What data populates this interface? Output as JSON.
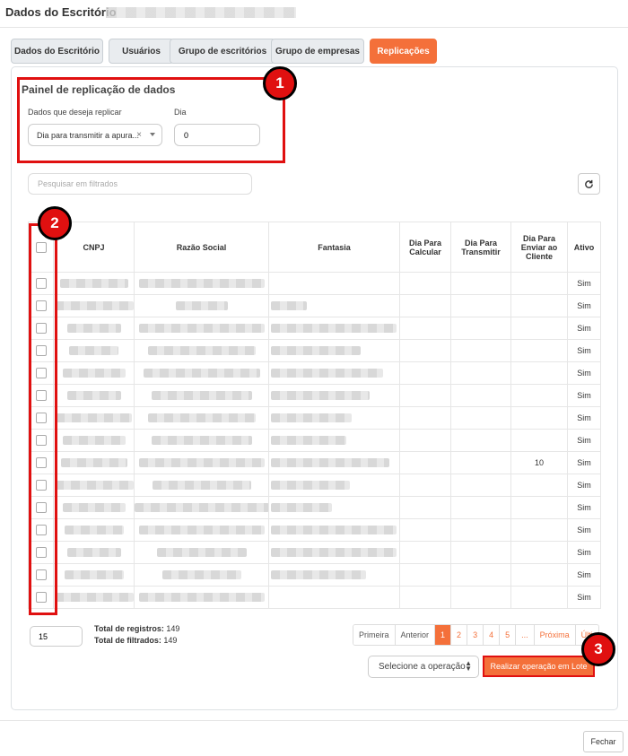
{
  "modal": {
    "title": "Dados do Escritório",
    "close_label": "Fechar"
  },
  "tabs": [
    {
      "label": "Dados do Escritório"
    },
    {
      "label": "Usuários"
    },
    {
      "label": "Grupo de escritórios"
    },
    {
      "label": "Grupo de empresas"
    },
    {
      "label": "Replicações",
      "active": true
    }
  ],
  "painel": {
    "title": "Painel de replicação de dados",
    "dados_label": "Dados que deseja replicar",
    "dados_value": "Dia para transmitir a apura...",
    "dia_label": "Dia",
    "dia_value": "0"
  },
  "search": {
    "placeholder": "Pesquisar em filtrados"
  },
  "table": {
    "headers": [
      "",
      "CNPJ",
      "Razão Social",
      "Fantasia",
      "Dia Para Calcular",
      "Dia Para Transmitir",
      "Dia Para Enviar ao Cliente",
      "Ativo"
    ],
    "rows": [
      {
        "enviar": "",
        "ativo": "Sim"
      },
      {
        "enviar": "",
        "ativo": "Sim"
      },
      {
        "enviar": "",
        "ativo": "Sim"
      },
      {
        "enviar": "",
        "ativo": "Sim"
      },
      {
        "enviar": "",
        "ativo": "Sim"
      },
      {
        "enviar": "",
        "ativo": "Sim"
      },
      {
        "enviar": "",
        "ativo": "Sim"
      },
      {
        "enviar": "",
        "ativo": "Sim"
      },
      {
        "enviar": "10",
        "ativo": "Sim"
      },
      {
        "enviar": "",
        "ativo": "Sim"
      },
      {
        "enviar": "",
        "ativo": "Sim"
      },
      {
        "enviar": "",
        "ativo": "Sim"
      },
      {
        "enviar": "",
        "ativo": "Sim"
      },
      {
        "enviar": "",
        "ativo": "Sim"
      },
      {
        "enviar": "",
        "ativo": "Sim"
      }
    ]
  },
  "footer": {
    "page_size": "15",
    "total_registros_label": "Total de registros:",
    "total_registros": "149",
    "total_filtrados_label": "Total de filtrados:",
    "total_filtrados": "149",
    "pager": [
      "Primeira",
      "Anterior",
      "1",
      "2",
      "3",
      "4",
      "5",
      "...",
      "Próxima",
      "Últi"
    ],
    "operacao_placeholder": "Selecione a operação",
    "lote_button": "Realizar operação em Lote"
  },
  "annotations": {
    "badge1": "1",
    "badge2": "2",
    "badge3": "3",
    "color": "#e01010"
  },
  "colors": {
    "accent": "#f4703a"
  }
}
